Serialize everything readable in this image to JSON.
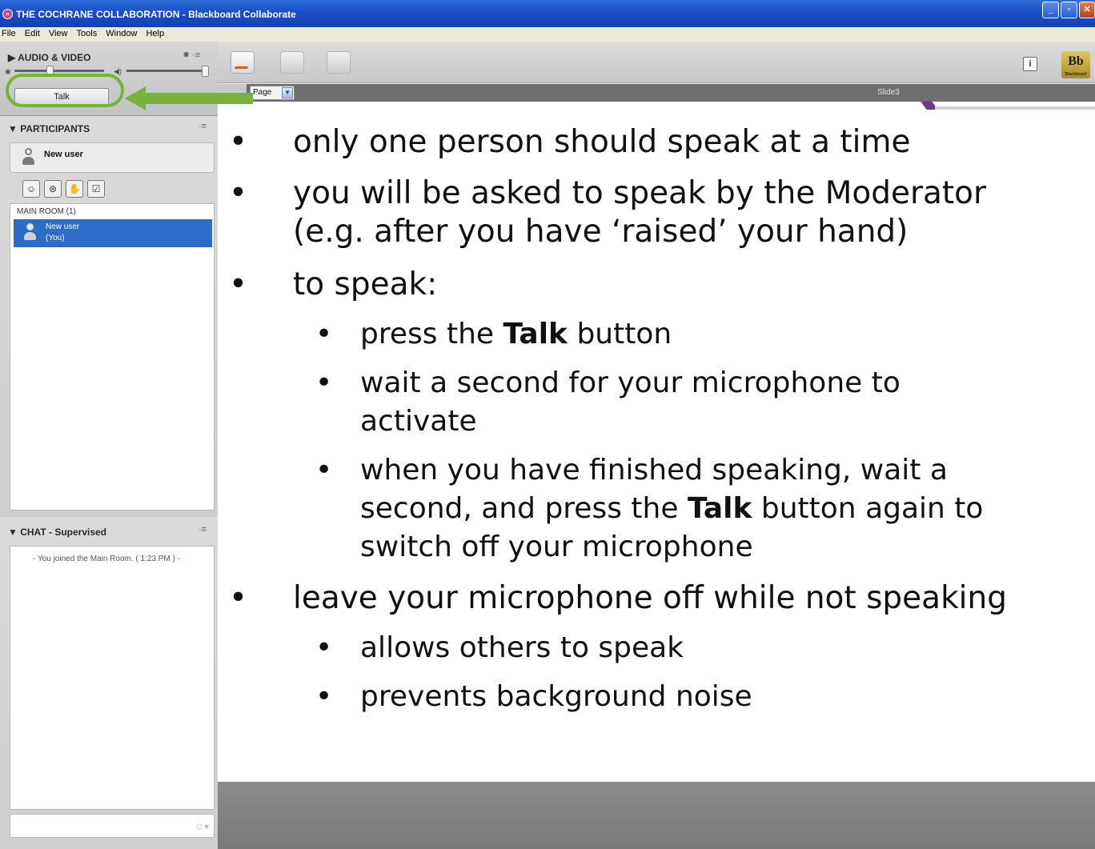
{
  "window": {
    "title": "THE COCHRANE COLLABORATION - Blackboard Collaborate",
    "minimize": "_",
    "maximize": "▫",
    "close": "✕"
  },
  "menu": [
    "File",
    "Edit",
    "View",
    "Tools",
    "Window",
    "Help"
  ],
  "audio_video": {
    "title": "AUDIO & VIDEO",
    "talk_label": "Talk"
  },
  "participants": {
    "title": "PARTICIPANTS",
    "current_user": "New user",
    "room_label": "MAIN ROOM (1)",
    "room_user": "New user",
    "room_user_note": "(You)"
  },
  "chat": {
    "title": "CHAT - Supervised",
    "message": "- You joined the Main Room. ( 1:23 PM ) -"
  },
  "page_selector": "Page",
  "slide_name": "Slide3",
  "slide": {
    "bullets": [
      {
        "level": 1,
        "text": "only one person should speak at a time"
      },
      {
        "level": 1,
        "text": "you will be asked to speak by the Moderator",
        "text2": "(e.g. after you have ‘raised’ your hand)"
      },
      {
        "level": 1,
        "text": "to speak:"
      },
      {
        "level": 2,
        "pre": "press the ",
        "bold": "Talk",
        "post": " button"
      },
      {
        "level": 2,
        "text": "wait a second for your microphone to",
        "text2": "activate"
      },
      {
        "level": 2,
        "text": "when you have finished speaking, wait a",
        "pre2": "second, and press the ",
        "bold2": "Talk",
        "post2": " button again to",
        "text3": "switch off your microphone"
      },
      {
        "level": 1,
        "text": "leave your microphone off while not speaking"
      },
      {
        "level": 2,
        "text": "allows others to speak"
      },
      {
        "level": 2,
        "text": "prevents background noise"
      }
    ]
  },
  "colors": {
    "highlight": "#78b23a",
    "selection": "#2f6cc8",
    "titlebar": "#1a4fc4"
  },
  "icons": {
    "emoticon": "☺",
    "raise_hand": "✋",
    "info": "i",
    "bb_logo": "Bb",
    "bb_logo_caption": "Blackboard"
  }
}
